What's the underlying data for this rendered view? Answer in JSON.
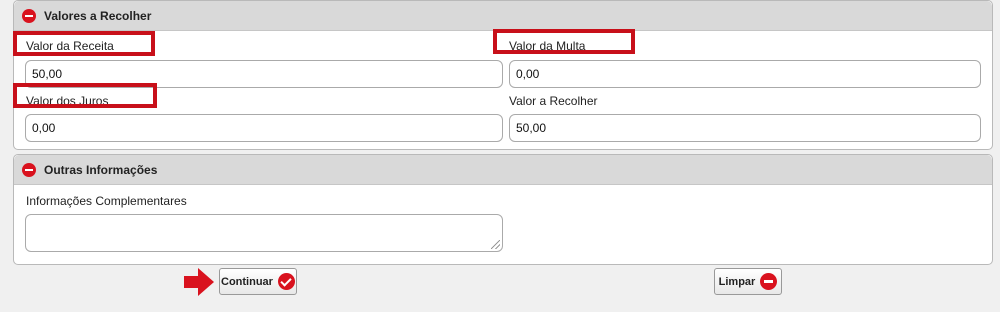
{
  "valores_section": {
    "title": "Valores a Recolher",
    "valor_receita": {
      "label": "Valor da Receita",
      "value": "50,00"
    },
    "valor_multa": {
      "label": "Valor da Multa",
      "value": "0,00"
    },
    "valor_juros": {
      "label": "Valor dos Juros",
      "value": "0,00"
    },
    "valor_recolher": {
      "label": "Valor a Recolher",
      "value": "50,00"
    }
  },
  "outras_section": {
    "title": "Outras Informações",
    "complementares": {
      "label": "Informações Complementares",
      "value": ""
    }
  },
  "buttons": {
    "continuar": "Continuar",
    "limpar": "Limpar"
  },
  "colors": {
    "accent_red": "#d9121e",
    "highlight_red": "#c8101a",
    "header_gray": "#d9d9d9"
  }
}
